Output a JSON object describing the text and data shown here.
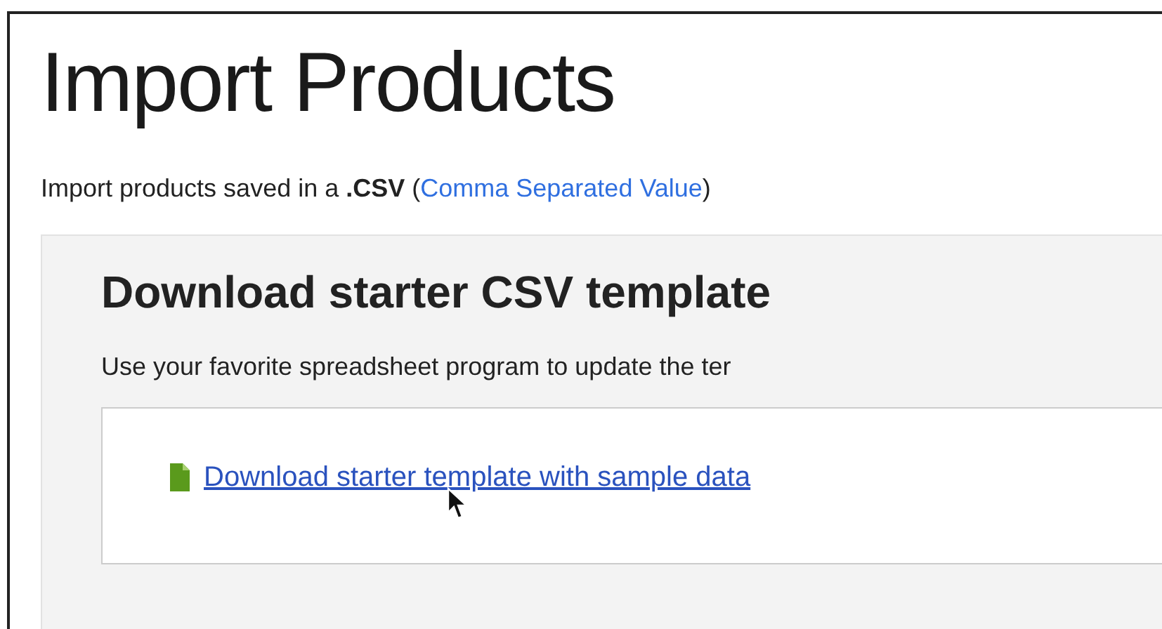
{
  "page": {
    "title": "Import Products",
    "intro": {
      "text": "Import products saved in a **.CSV** (",
      "link": "Comma Separated Value",
      "after": ")"
    }
  },
  "template_section": {
    "heading": "Download starter CSV template",
    "description": "Use your favorite spreadsheet program to update the ter",
    "download_link": "Download starter template with sample data"
  }
}
